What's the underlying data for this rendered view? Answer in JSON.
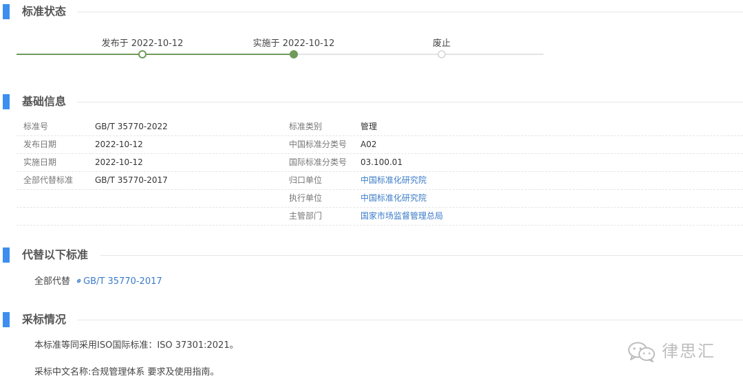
{
  "sections": {
    "status": "标准状态",
    "basic": "基础信息",
    "replaces": "代替以下标准",
    "adoption": "采标情况"
  },
  "timeline": {
    "progress_fraction": 0.523,
    "steps": [
      {
        "label": "发布于 2022-10-12",
        "state": "done"
      },
      {
        "label": "实施于 2022-10-12",
        "state": "current"
      },
      {
        "label": "废止",
        "state": "inactive"
      }
    ]
  },
  "basic_info": {
    "rows": [
      {
        "l1": "标准号",
        "v1": "GB/T 35770-2022",
        "l2": "标准类别",
        "v2": "管理"
      },
      {
        "l1": "发布日期",
        "v1": "2022-10-12",
        "l2": "中国标准分类号",
        "v2": "A02"
      },
      {
        "l1": "实施日期",
        "v1": "2022-10-12",
        "l2": "国际标准分类号",
        "v2": "03.100.01"
      },
      {
        "l1": "全部代替标准",
        "v1": "GB/T 35770-2017",
        "l2": "归口单位",
        "v2": "中国标准化研究院"
      },
      {
        "l1": "",
        "v1": "",
        "l2": "执行单位",
        "v2": "中国标准化研究院"
      },
      {
        "l1": "",
        "v1": "",
        "l2": "主管部门",
        "v2": "国家市场监督管理总局"
      }
    ]
  },
  "replaces": {
    "prefix": "全部代替",
    "link_icon": "link-icon",
    "link_text": "GB/T 35770-2017"
  },
  "adoption": {
    "line1": "本标准等同采用ISO国际标准：ISO 37301:2021。",
    "line2": "采标中文名称:合规管理体系 要求及使用指南。"
  },
  "watermark": {
    "icon": "wechat-icon",
    "text": "律思汇"
  },
  "colors": {
    "accent_bar": "#3d8ef0",
    "timeline_green": "#6f9a5a",
    "link_blue": "#3a7bc8"
  }
}
